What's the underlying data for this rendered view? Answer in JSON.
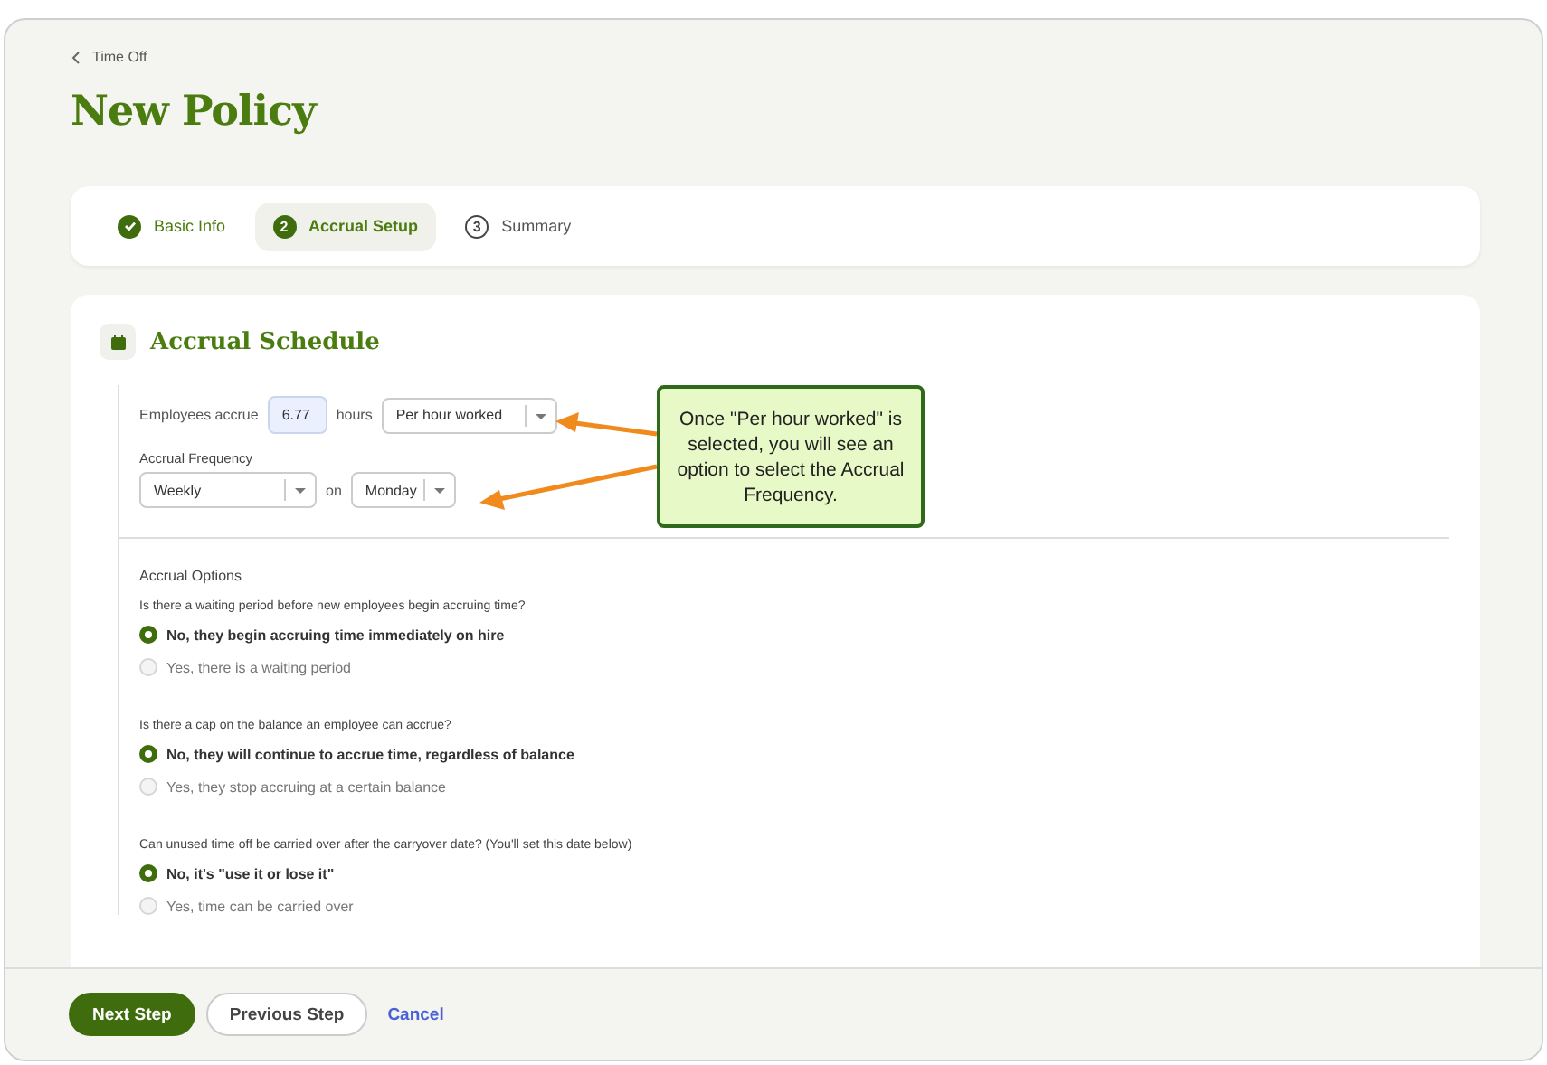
{
  "breadcrumb": {
    "label": "Time Off"
  },
  "title": "New Policy",
  "steps": [
    {
      "kind": "complete",
      "label": "Basic Info",
      "selected": false
    },
    {
      "kind": "numbered",
      "number": "2",
      "label": "Accrual Setup",
      "selected": true
    },
    {
      "kind": "numbered",
      "number": "3",
      "label": "Summary",
      "selected": false
    }
  ],
  "section": {
    "title": "Accrual Schedule",
    "accrue": {
      "prefix": "Employees accrue",
      "value": "6.77",
      "unit": "hours",
      "basis": "Per hour worked"
    },
    "frequency": {
      "label": "Accrual Frequency",
      "value": "Weekly",
      "joiner": "on",
      "day": "Monday"
    },
    "options_title": "Accrual Options",
    "questions": [
      {
        "prompt": "Is there a waiting period before new employees begin accruing time?",
        "options": [
          {
            "label": "No, they begin accruing time immediately on hire",
            "selected": true
          },
          {
            "label": "Yes, there is a waiting period",
            "selected": false
          }
        ]
      },
      {
        "prompt": "Is there a cap on the balance an employee can accrue?",
        "options": [
          {
            "label": "No, they will continue to accrue time, regardless of balance",
            "selected": true
          },
          {
            "label": "Yes, they stop accruing at a certain balance",
            "selected": false
          }
        ]
      },
      {
        "prompt": "Can unused time off be carried over after the carryover date? (You'll set this date below)",
        "options": [
          {
            "label": "No, it's \"use it or lose it\"",
            "selected": true
          },
          {
            "label": "Yes, time can be carried over",
            "selected": false
          }
        ]
      }
    ]
  },
  "callout": {
    "text": "Once \"Per hour worked\" is selected, you will see an option to select the Accrual Frequency."
  },
  "footer": {
    "buttons": [
      {
        "label": "Next Step",
        "kind": "primary"
      },
      {
        "label": "Previous Step",
        "kind": "secondary"
      },
      {
        "label": "Cancel",
        "kind": "link"
      }
    ]
  }
}
